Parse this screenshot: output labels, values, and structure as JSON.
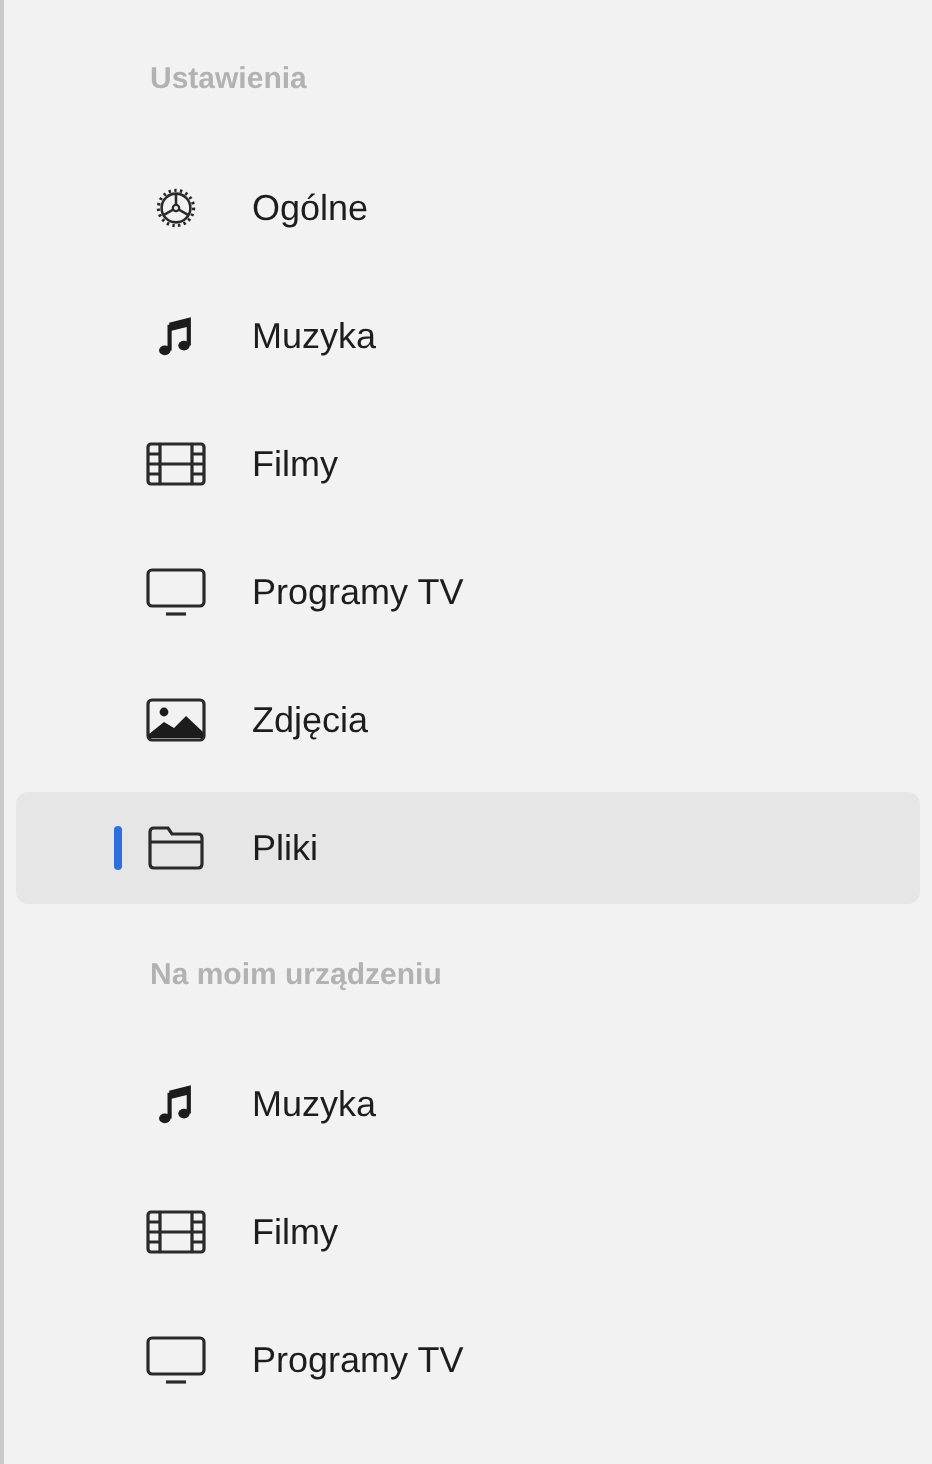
{
  "sections": [
    {
      "title": "Ustawienia",
      "items": [
        {
          "label": "Ogólne",
          "kind": "gear",
          "selected": false
        },
        {
          "label": "Muzyka",
          "kind": "music",
          "selected": false
        },
        {
          "label": "Filmy",
          "kind": "film",
          "selected": false
        },
        {
          "label": "Programy TV",
          "kind": "tv",
          "selected": false
        },
        {
          "label": "Zdjęcia",
          "kind": "photo",
          "selected": false
        },
        {
          "label": "Pliki",
          "kind": "folder",
          "selected": true
        }
      ]
    },
    {
      "title": "Na moim urządzeniu",
      "items": [
        {
          "label": "Muzyka",
          "kind": "music",
          "selected": false
        },
        {
          "label": "Filmy",
          "kind": "film",
          "selected": false
        },
        {
          "label": "Programy TV",
          "kind": "tv",
          "selected": false
        }
      ]
    }
  ]
}
